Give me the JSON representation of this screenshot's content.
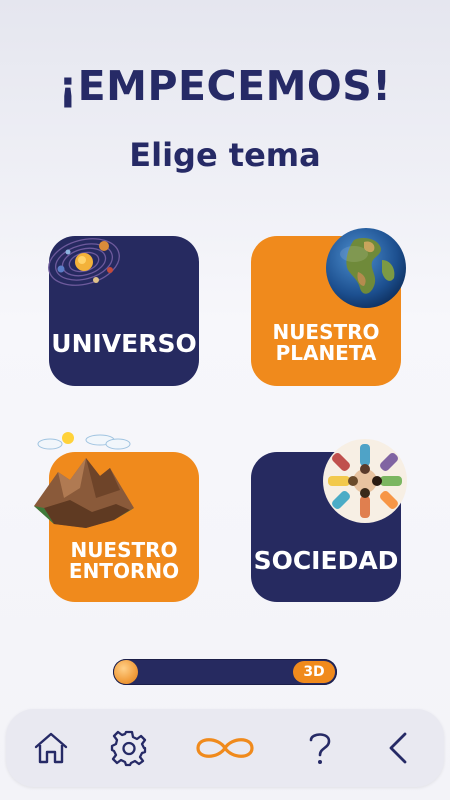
{
  "header": {
    "title": "¡EMPECEMOS!",
    "subtitle": "Elige tema"
  },
  "topics": [
    {
      "label": "UNIVERSO",
      "icon": "solar-system-icon",
      "color": "#262a60"
    },
    {
      "label_line1": "NUESTRO",
      "label_line2": "PLANETA",
      "icon": "earth-globe-icon",
      "color": "#f08a1c"
    },
    {
      "label_line1": "NUESTRO",
      "label_line2": "ENTORNO",
      "icon": "mountain-landscape-icon",
      "color": "#f08a1c"
    },
    {
      "label": "SOCIEDAD",
      "icon": "people-circle-icon",
      "color": "#262a60"
    }
  ],
  "view_toggle": {
    "badge": "3D",
    "accent": "#f08a1c"
  },
  "navbar": {
    "items": [
      "home-icon",
      "gear-icon",
      "infinity-icon",
      "help-icon",
      "back-icon"
    ],
    "active_color": "#f08a1c",
    "icon_color": "#262a66"
  },
  "colors": {
    "navy": "#262a60",
    "orange": "#f08a1c",
    "title": "#262a66"
  }
}
